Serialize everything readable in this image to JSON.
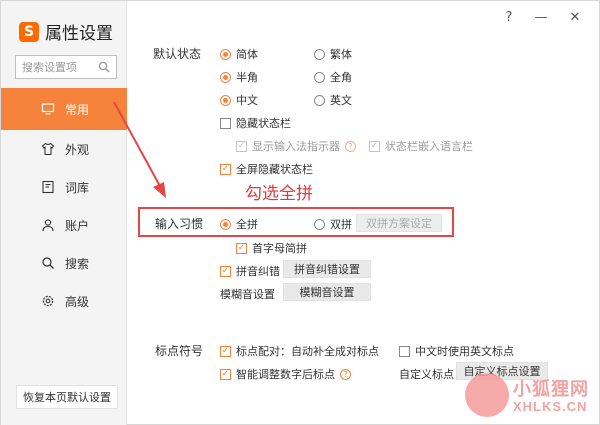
{
  "app": {
    "title": "属性设置",
    "logo_letter": "S"
  },
  "window_controls": {
    "help": "?",
    "minimize": "—",
    "close": "✕"
  },
  "search": {
    "placeholder": "搜索设置项"
  },
  "sidebar": {
    "items": [
      {
        "label": "常用",
        "icon": "monitor-icon",
        "active": true
      },
      {
        "label": "外观",
        "icon": "shirt-icon",
        "active": false
      },
      {
        "label": "词库",
        "icon": "dictionary-icon",
        "active": false
      },
      {
        "label": "账户",
        "icon": "user-icon",
        "active": false
      },
      {
        "label": "搜索",
        "icon": "search-icon",
        "active": false
      },
      {
        "label": "高级",
        "icon": "gear-icon",
        "active": false
      }
    ],
    "restore_button": "恢复本页默认设置"
  },
  "default_state": {
    "label": "默认状态",
    "options": [
      "简体",
      "繁体",
      "半角",
      "全角",
      "中文",
      "英文"
    ],
    "selected": [
      "简体",
      "半角",
      "中文"
    ],
    "hide_statusbar": "隐藏状态栏",
    "show_indicator": "显示输入法指示器",
    "embed_in_lang_bar": "状态栏嵌入语言栏",
    "fullscreen_hide": "全屏隐藏状态栏"
  },
  "input_habit": {
    "label": "输入习惯",
    "full_pinyin": "全拼",
    "double_pinyin": "双拼",
    "double_pinyin_settings": "双拼方案设定",
    "first_letter_abbr": "首字母简拼",
    "pinyin_correction": "拼音纠错",
    "pinyin_correction_settings": "拼音纠错设置",
    "fuzzy_sound": "模糊音设置",
    "fuzzy_sound_button": "模糊音设置"
  },
  "annotation": {
    "text": "勾选全拼"
  },
  "punctuation": {
    "label": "标点符号",
    "pairing": "标点配对：自动补全成对标点",
    "english_punct_in_chinese": "中文时使用英文标点",
    "smart_adjust": "智能调整数字后标点",
    "custom_label": "自定义标点",
    "custom_button": "自定义标点设置"
  },
  "watermark": {
    "text": "小狐狸网",
    "url": "XHLKS.CN"
  },
  "colors": {
    "accent": "#f5833b",
    "annotation": "#e03a3a"
  }
}
